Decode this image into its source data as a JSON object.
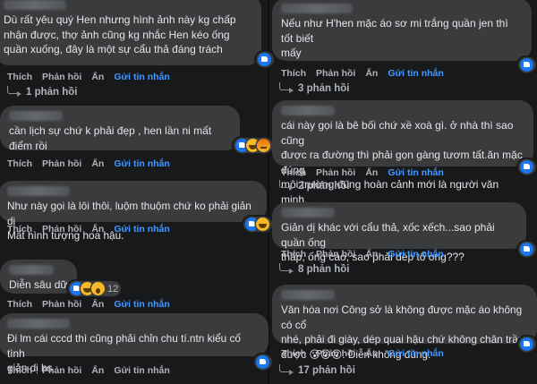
{
  "actions": {
    "like": "Thích",
    "reply": "Phản hồi",
    "hide": "Ẩn",
    "send_message": "Gửi tin nhắn"
  },
  "left": [
    {
      "text": "Dù rất yêu quý Hen nhưng hình ảnh này kg chấp\nnhận được, thợ ảnh cũng kg nhắc Hen kéo ống\nquần xuống, đây là một sự cẩu thả đáng trách",
      "reactions": [
        "like"
      ],
      "reaction_count": "",
      "replies": "1 phản hồi"
    },
    {
      "text": "cần lịch sự chứ k phải đẹp , hen lần ni mất\nđiểm rồi",
      "reactions": [
        "like",
        "haha",
        "angry"
      ],
      "reaction_count": "",
      "replies": ""
    },
    {
      "text": "Như này gọi là lôi thôi, luộm thuộm chứ ko phải giản dị\nMất hình tượng hoa hậu.",
      "reactions": [
        "like",
        "haha"
      ],
      "reaction_count": "",
      "replies": ""
    },
    {
      "text": "Diễn sâu dữ",
      "reactions": [
        "like",
        "haha",
        "wow"
      ],
      "reaction_count": "12",
      "replies": ""
    },
    {
      "text": "Đi lm cái cccd thì cũng phải chỉn chu tí.ntn kiểu cố tình\ngiản dị hs",
      "reactions": [
        "like"
      ],
      "reaction_count": "",
      "replies": ""
    }
  ],
  "right": [
    {
      "text": "Nếu như H'hen mặc áo sơ mi trắng quần jen thì tốt biết\nmấy",
      "reactions": [
        "like"
      ],
      "reaction_count": "",
      "replies": "3 phản hồi"
    },
    {
      "text": "cái này gọi là bê bối chứ xề xoà gì. ở nhà thì sao cũng\nđược ra đường thì phải gọn gàng tươm tất.ăn mặc đúng\nmôi trường đúng hoàn cảnh mới là người văn minh.",
      "reactions": [
        "like"
      ],
      "reaction_count": "",
      "replies": "2 phản hồi"
    },
    {
      "text": "Giản dị khác với cẩu thả, xốc xếch...sao phải quần ống\nthấp, ống cao, sao phải dép tổ ong???",
      "reactions": [
        "like"
      ],
      "reaction_count": "",
      "replies": "8 phản hồi"
    },
    {
      "text": "Văn hóa nơi Công sở là không được mặc áo không có cổ\nnhé, phải đi giày, dép quai hậu chứ không chân trần\nđược 😮😮😮. Diễn không đúng.",
      "reactions": [
        "like"
      ],
      "reaction_count": "",
      "replies": "17 phản hồi"
    }
  ]
}
